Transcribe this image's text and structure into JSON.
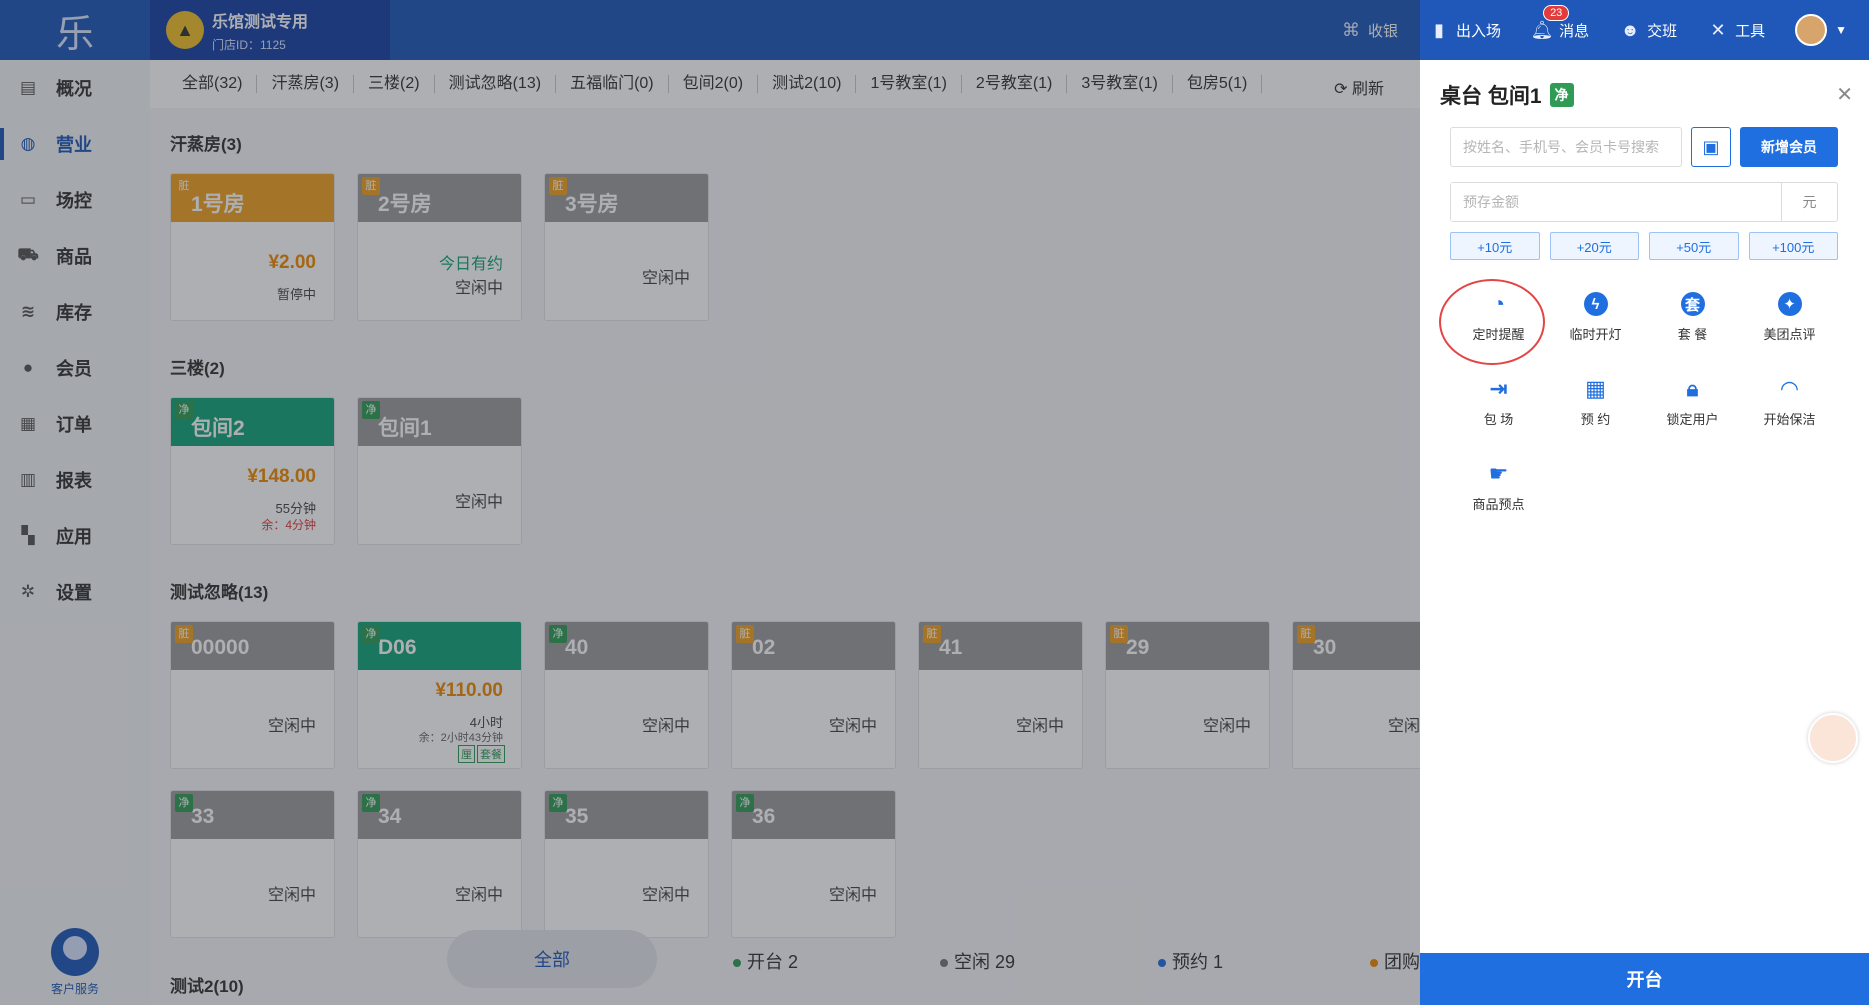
{
  "topbar": {
    "logo": "乐",
    "store_name": "乐馆测试专用",
    "store_id": "门店ID：1125",
    "actions": [
      {
        "label": "收银"
      },
      {
        "label": "出入场"
      },
      {
        "label": "消息",
        "badge": "23"
      },
      {
        "label": "交班"
      },
      {
        "label": "工具"
      }
    ]
  },
  "sidebar": {
    "items": [
      {
        "label": "概况"
      },
      {
        "label": "营业"
      },
      {
        "label": "场控"
      },
      {
        "label": "商品"
      },
      {
        "label": "库存"
      },
      {
        "label": "会员"
      },
      {
        "label": "订单"
      },
      {
        "label": "报表"
      },
      {
        "label": "应用"
      },
      {
        "label": "设置"
      }
    ],
    "active_index": 1,
    "service_label": "客户服务"
  },
  "tabs": [
    "全部(32)",
    "汗蒸房(3)",
    "三楼(2)",
    "测试忽略(13)",
    "五福临门(0)",
    "包间2(0)",
    "测试2(10)",
    "1号教室(1)",
    "2号教室(1)",
    "3号教室(1)",
    "包房5(1)"
  ],
  "refresh_label": "刷新",
  "sections": [
    {
      "title": "汗蒸房(3)"
    },
    {
      "title": "三楼(2)"
    },
    {
      "title": "测试忽略(13)"
    },
    {
      "title": "测试2(10)"
    }
  ],
  "cards": {
    "c1": {
      "tag": "脏",
      "name": "1号房",
      "price": "¥2.00",
      "status": "暂停中"
    },
    "c2": {
      "tag": "脏",
      "name": "2号房",
      "note": "今日有约",
      "status": "空闲中"
    },
    "c3": {
      "tag": "脏",
      "name": "3号房",
      "status": "空闲中"
    },
    "c4": {
      "tag": "净",
      "name": "包间2",
      "price": "¥148.00",
      "duration": "55分钟",
      "remain": "余：4分钟"
    },
    "c5": {
      "tag": "净",
      "name": "包间1",
      "status": "空闲中"
    },
    "c6": {
      "tag": "脏",
      "name": "00000",
      "status": "空闲中"
    },
    "c7": {
      "tag": "净",
      "name": "D06",
      "price": "¥110.00",
      "duration": "4小时",
      "remain": "余：2小时43分钟",
      "mini_tags": [
        "厘",
        "套餐"
      ]
    },
    "c8": {
      "tag": "净",
      "name": "40",
      "status": "空闲中"
    },
    "c9": {
      "tag": "脏",
      "name": "02",
      "status": "空闲中"
    },
    "c10": {
      "tag": "脏",
      "name": "41",
      "status": "空闲中"
    },
    "c11": {
      "tag": "脏",
      "name": "29",
      "status": "空闲中"
    },
    "c12": {
      "tag": "脏",
      "name": "30",
      "status": "空闲中"
    },
    "c13": {
      "tag": "净",
      "name": "33",
      "status": "空闲中"
    },
    "c14": {
      "tag": "净",
      "name": "34",
      "status": "空闲中"
    },
    "c15": {
      "tag": "净",
      "name": "35",
      "status": "空闲中"
    },
    "c16": {
      "tag": "净",
      "name": "36",
      "status": "空闲中"
    }
  },
  "bottom_stats": {
    "all": "全部",
    "open": "开台 2",
    "idle": "空闲 29",
    "reserved": "预约 1",
    "group": "团购",
    "colors": {
      "open": "#2f9b55",
      "idle": "#777777",
      "reserved": "#1f6fe0",
      "group": "#f08a00"
    }
  },
  "panel": {
    "title": "桌台 包间1",
    "tag": "净",
    "search_placeholder": "按姓名、手机号、会员卡号搜索",
    "new_member": "新增会员",
    "amount_placeholder": "预存金额",
    "amount_unit": "元",
    "quick_amounts": [
      "+10元",
      "+20元",
      "+50元",
      "+100元"
    ],
    "functions": [
      {
        "label": "定时提醒",
        "icon": "timer-icon"
      },
      {
        "label": "临时开灯",
        "icon": "lightning-icon"
      },
      {
        "label": "套 餐",
        "icon": "package-icon"
      },
      {
        "label": "美团点评",
        "icon": "meituan-icon"
      },
      {
        "label": "包 场",
        "icon": "enter-icon"
      },
      {
        "label": "预 约",
        "icon": "calendar-icon"
      },
      {
        "label": "锁定用户",
        "icon": "lock-icon"
      },
      {
        "label": "开始保洁",
        "icon": "refresh-icon"
      },
      {
        "label": "商品预点",
        "icon": "hand-tap-icon"
      }
    ],
    "open_button": "开台"
  },
  "colors": {
    "primary": "#1f58b8",
    "accent": "#1f6fe0",
    "dirty": "#f0a023",
    "clean": "#2f9b55",
    "occupied": "#12a378"
  }
}
